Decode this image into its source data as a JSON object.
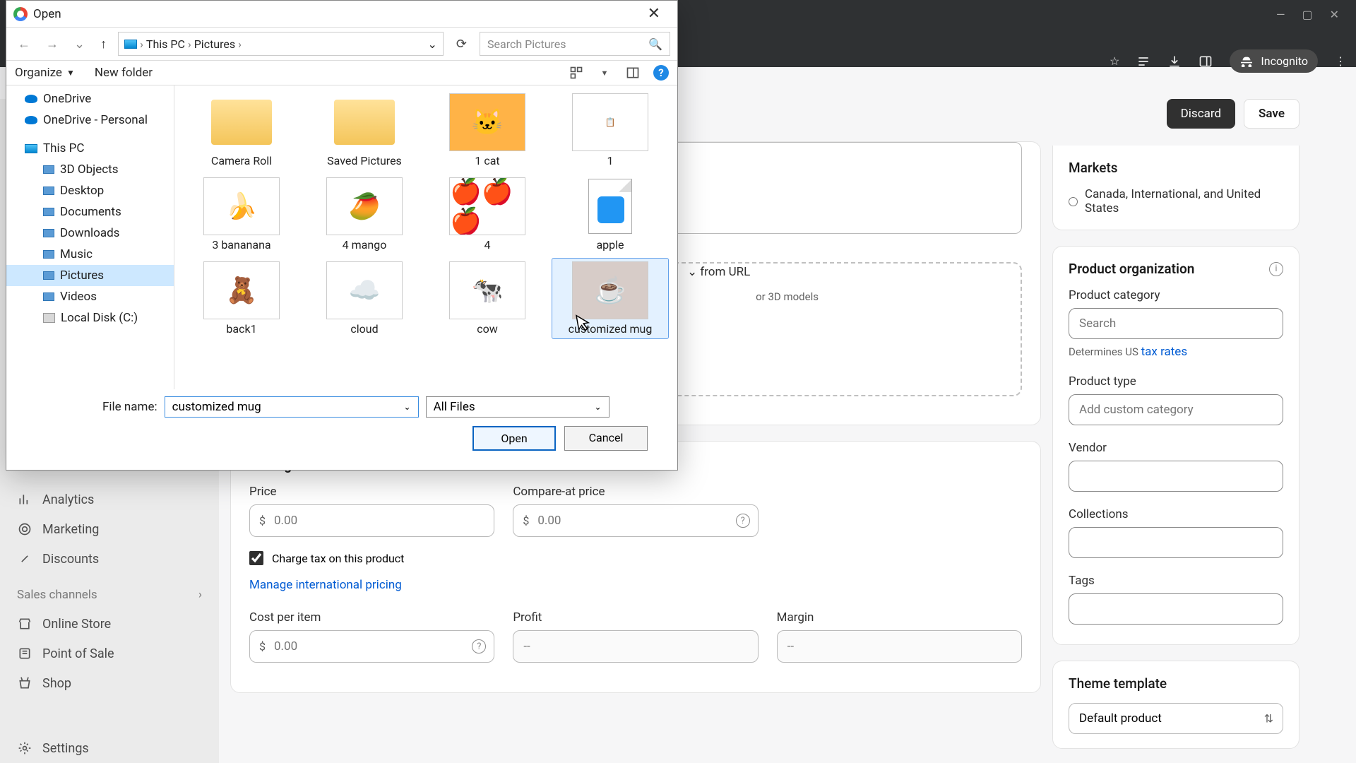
{
  "browser": {
    "minimize": "—",
    "maximize": "▢",
    "close": "✕",
    "incognito": "Incognito"
  },
  "shopify": {
    "header": {
      "discard": "Discard",
      "save": "Save"
    },
    "sidebar": {
      "analytics": "Analytics",
      "marketing": "Marketing",
      "discounts": "Discounts",
      "sales_channels": "Sales channels",
      "online_store": "Online Store",
      "pos": "Point of Sale",
      "shop": "Shop",
      "settings": "Settings"
    },
    "media": {
      "from_url": "from URL",
      "hint": "or 3D models"
    },
    "pricing": {
      "title": "Pricing",
      "price": "Price",
      "compare": "Compare-at price",
      "zero": "0.00",
      "currency": "$",
      "charge_tax": "Charge tax on this product",
      "intl": "Manage international pricing",
      "cost": "Cost per item",
      "profit": "Profit",
      "margin": "Margin",
      "dashes": "--"
    },
    "right": {
      "markets_title": "Markets",
      "markets_value": "Canada, International, and United States",
      "org_title": "Product organization",
      "category": "Product category",
      "search_ph": "Search",
      "determines": "Determines US ",
      "tax_rates": "tax rates",
      "type": "Product type",
      "type_ph": "Add custom category",
      "vendor": "Vendor",
      "collections": "Collections",
      "tags": "Tags",
      "theme": "Theme template",
      "theme_default": "Default product"
    }
  },
  "dialog": {
    "title": "Open",
    "breadcrumb": {
      "pc": "This PC",
      "folder": "Pictures"
    },
    "search_ph": "Search Pictures",
    "organize": "Organize",
    "new_folder": "New folder",
    "tree": {
      "onedrive": "OneDrive",
      "onedrive_p": "OneDrive - Personal",
      "this_pc": "This PC",
      "objects3d": "3D Objects",
      "desktop": "Desktop",
      "documents": "Documents",
      "downloads": "Downloads",
      "music": "Music",
      "pictures": "Pictures",
      "videos": "Videos",
      "disk": "Local Disk (C:)"
    },
    "files": {
      "camera_roll": "Camera Roll",
      "saved_pictures": "Saved Pictures",
      "cat1": "1 cat",
      "one": "1",
      "banana": "3 bananana",
      "mango": "4 mango",
      "four": "4",
      "apple": "apple",
      "back1": "back1",
      "cloud": "cloud",
      "cow": "cow",
      "mug": "customized mug"
    },
    "filename_label": "File name:",
    "filename_value": "customized mug",
    "filter": "All Files",
    "open_btn": "Open",
    "cancel_btn": "Cancel"
  }
}
